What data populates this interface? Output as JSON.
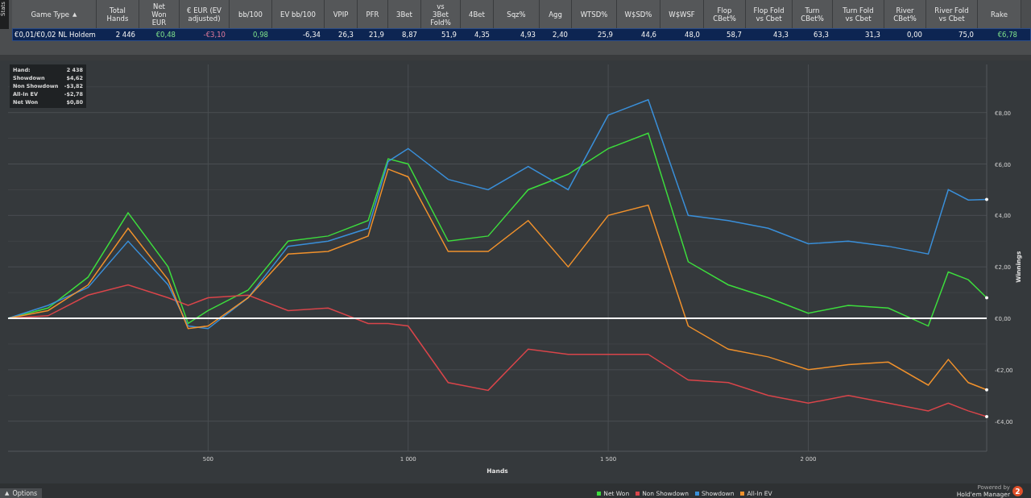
{
  "side_tab": {
    "label": "Stats"
  },
  "table": {
    "columns": [
      {
        "label": "Game Type",
        "sort_indicator": "▲"
      },
      {
        "label": "Total\nHands"
      },
      {
        "label": "Net\nWon\nEUR"
      },
      {
        "label": "€ EUR (EV\nadjusted)"
      },
      {
        "label": "bb/100"
      },
      {
        "label": "EV bb/100"
      },
      {
        "label": "VPIP"
      },
      {
        "label": "PFR"
      },
      {
        "label": "3Bet"
      },
      {
        "label": "vs\n3Bet\nFold%"
      },
      {
        "label": "4Bet"
      },
      {
        "label": "Sqz%"
      },
      {
        "label": "Agg"
      },
      {
        "label": "WTSD%"
      },
      {
        "label": "W$SD%"
      },
      {
        "label": "W$WSF"
      },
      {
        "label": "Flop\nCBet%"
      },
      {
        "label": "Flop Fold\nvs Cbet"
      },
      {
        "label": "Turn\nCBet%"
      },
      {
        "label": "Turn Fold\nvs Cbet"
      },
      {
        "label": "River\nCBet%"
      },
      {
        "label": "River Fold\nvs Cbet"
      },
      {
        "label": "Rake"
      }
    ],
    "rows": [
      {
        "selected": true,
        "cells": [
          {
            "text": "€0,01/€0,02 NL Holdem"
          },
          {
            "text": "2 446"
          },
          {
            "text": "€0,48",
            "kind": "positive"
          },
          {
            "text": "-€3,10",
            "kind": "negative"
          },
          {
            "text": "0,98",
            "kind": "positive"
          },
          {
            "text": "-6,34"
          },
          {
            "text": "26,3"
          },
          {
            "text": "21,9"
          },
          {
            "text": "8,87"
          },
          {
            "text": "51,9"
          },
          {
            "text": "4,35"
          },
          {
            "text": "4,93"
          },
          {
            "text": "2,40"
          },
          {
            "text": "25,9"
          },
          {
            "text": "44,6"
          },
          {
            "text": "48,0"
          },
          {
            "text": "58,7"
          },
          {
            "text": "43,3"
          },
          {
            "text": "63,3"
          },
          {
            "text": "31,3"
          },
          {
            "text": "0,00"
          },
          {
            "text": "75,0"
          },
          {
            "text": "€6,78",
            "kind": "positive"
          }
        ]
      }
    ]
  },
  "tooltip": {
    "rows": [
      {
        "label": "Hand:",
        "value": "2 438"
      },
      {
        "label": "Showdown",
        "value": "$4,62"
      },
      {
        "label": "Non Showdown",
        "value": "-$3,82"
      },
      {
        "label": "All-In EV",
        "value": "-$2,78"
      },
      {
        "label": "Net Won",
        "value": "$0,80"
      }
    ]
  },
  "chart_data": {
    "type": "line",
    "xlabel": "Hands",
    "ylabel": "Winnings",
    "x": [
      0,
      100,
      200,
      300,
      400,
      450,
      500,
      600,
      700,
      800,
      900,
      950,
      1000,
      1100,
      1200,
      1300,
      1400,
      1500,
      1600,
      1700,
      1800,
      1900,
      2000,
      2100,
      2200,
      2300,
      2350,
      2400,
      2446
    ],
    "series": [
      {
        "name": "Net Won",
        "color": "#3ddc3d",
        "values": [
          0,
          0.4,
          1.6,
          4.1,
          2.0,
          -0.2,
          0.3,
          1.1,
          3.0,
          3.2,
          3.8,
          6.2,
          6.0,
          3.0,
          3.2,
          5.0,
          5.6,
          6.6,
          7.2,
          2.2,
          1.3,
          0.8,
          0.2,
          0.5,
          0.4,
          -0.3,
          1.8,
          1.5,
          0.8
        ]
      },
      {
        "name": "Non Showdown",
        "color": "#d9454a",
        "values": [
          0,
          0.1,
          0.9,
          1.3,
          0.8,
          0.5,
          0.8,
          0.9,
          0.3,
          0.4,
          -0.2,
          -0.2,
          -0.3,
          -2.5,
          -2.8,
          -1.2,
          -1.4,
          -1.4,
          -1.4,
          -2.4,
          -2.5,
          -3.0,
          -3.3,
          -3.0,
          -3.3,
          -3.6,
          -3.3,
          -3.6,
          -3.82
        ]
      },
      {
        "name": "Showdown",
        "color": "#3a8fd9",
        "values": [
          0,
          0.5,
          1.2,
          3.0,
          1.3,
          -0.3,
          -0.4,
          0.8,
          2.8,
          3.0,
          3.5,
          6.1,
          6.6,
          5.4,
          5.0,
          5.9,
          5.0,
          7.9,
          8.5,
          4.0,
          3.8,
          3.5,
          2.9,
          3.0,
          2.8,
          2.5,
          5.0,
          4.6,
          4.62
        ]
      },
      {
        "name": "All-In EV",
        "color": "#f0912c",
        "values": [
          0,
          0.3,
          1.3,
          3.5,
          1.5,
          -0.4,
          -0.3,
          0.8,
          2.5,
          2.6,
          3.2,
          5.8,
          5.5,
          2.6,
          2.6,
          3.8,
          2.0,
          4.0,
          4.4,
          -0.3,
          -1.2,
          -1.5,
          -2.0,
          -1.8,
          -1.7,
          -2.6,
          -1.6,
          -2.5,
          -2.78
        ]
      }
    ],
    "grid": true,
    "xlim": [
      0,
      2446
    ],
    "ylim": [
      -5.17,
      9.87
    ],
    "xticks": [
      {
        "value": 500,
        "label": "500"
      },
      {
        "value": 1000,
        "label": "1 000"
      },
      {
        "value": 1500,
        "label": "1 500"
      },
      {
        "value": 2000,
        "label": "2 000"
      }
    ],
    "yticks": [
      {
        "value": -4,
        "label": "-€4,00"
      },
      {
        "value": -2,
        "label": "-€2,00"
      },
      {
        "value": 0,
        "label": "€0,00"
      },
      {
        "value": 2,
        "label": "€2,00"
      },
      {
        "value": 4,
        "label": "€4,00"
      },
      {
        "value": 6,
        "label": "€6,00"
      },
      {
        "value": 8,
        "label": "€8,00"
      }
    ]
  },
  "footer": {
    "options_caret": "▲",
    "options_label": "Options",
    "powered_by": "Powered by",
    "brand": "Hold'em Manager",
    "brand_badge": "2"
  }
}
